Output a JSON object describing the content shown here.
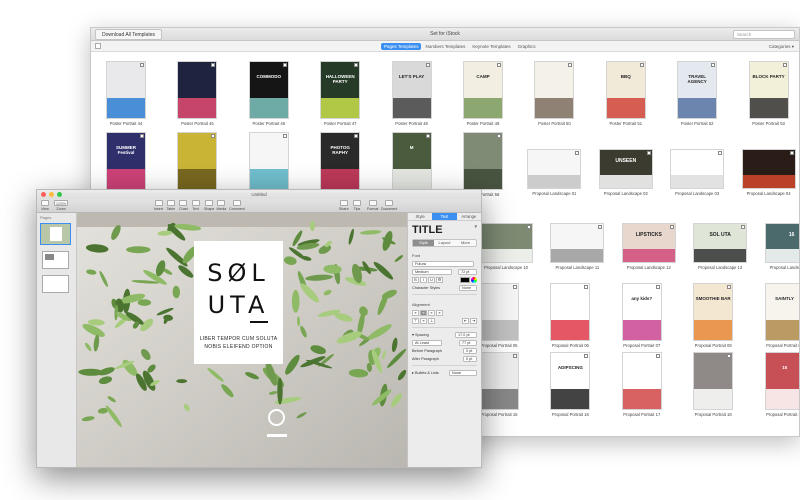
{
  "gallery": {
    "tab_label": "Download All Templates",
    "window_title": "Set for iStock",
    "search_placeholder": "Search",
    "tabs": [
      {
        "label": "Pages Templates",
        "active": true
      },
      {
        "label": "Numbers Templates",
        "active": false
      },
      {
        "label": "Keynote Templates",
        "active": false
      },
      {
        "label": "Graphics",
        "active": false
      }
    ],
    "categories_label": "Categories",
    "rows": [
      [
        {
          "caption": "Poster Portrait 44",
          "text": "",
          "bg": "#e9e9ec",
          "accent": "#2c7fd3"
        },
        {
          "caption": "Poster Portrait 45",
          "text": "",
          "bg": "#1e2340",
          "accent": "#e34b73"
        },
        {
          "caption": "Poster Portrait 46",
          "text": "COMMODO",
          "bg": "#151515",
          "accent": "#7ec6c1"
        },
        {
          "caption": "Poster Portrait 47",
          "text": "HALLOWEEN PARTY",
          "bg": "#263a28",
          "accent": "#c9e24a"
        },
        {
          "caption": "Poster Portrait 48",
          "text": "LET'S PLAY",
          "bg": "#d9d9d9",
          "accent": "#444444"
        },
        {
          "caption": "Poster Portrait 49",
          "text": "CAMP",
          "bg": "#f2efe2",
          "accent": "#7a9a5a"
        },
        {
          "caption": "Poster Portrait 50",
          "text": "",
          "bg": "#f4f1e8",
          "accent": "#7c6f5f"
        },
        {
          "caption": "Poster Portrait 51",
          "text": "BBQ",
          "bg": "#f1ead8",
          "accent": "#d1443b"
        },
        {
          "caption": "Poster Portrait 52",
          "text": "TRAVEL AGENCY",
          "bg": "#e4e9ef",
          "accent": "#5673a3"
        },
        {
          "caption": "Poster Portrait 53",
          "text": "BLOCK PARTY",
          "bg": "#f3f0d9",
          "accent": "#333333"
        }
      ],
      [
        {
          "caption": "",
          "text": "SUMMER Festival",
          "bg": "#2e2f6b",
          "accent": "#e9457a"
        },
        {
          "caption": "",
          "text": "",
          "bg": "#c9b436",
          "accent": "#6a5a1b"
        },
        {
          "caption": "",
          "text": "",
          "bg": "#f6f6f6",
          "accent": "#58b4c6"
        },
        {
          "caption": "",
          "text": "PHOTOG RAPHY",
          "bg": "#2a2a2a",
          "accent": "#d63b61"
        },
        {
          "caption": "",
          "text": "M",
          "bg": "#4b5b3e",
          "accent": "#ffffff"
        },
        {
          "caption": "Poster Portrait 58",
          "text": "",
          "bg": "#7f8b74",
          "accent": "#3e4a36"
        },
        {
          "caption": "Proposal Landscape 01",
          "text": "",
          "bg": "#f6f6f6",
          "accent": "#c4c4c4"
        },
        {
          "caption": "Proposal Landscape 02",
          "text": "UNSEEN",
          "bg": "#3b3b30",
          "accent": "#ffffff"
        },
        {
          "caption": "Proposal Landscape 03",
          "text": "",
          "bg": "#ffffff",
          "accent": "#dddddd"
        },
        {
          "caption": "Proposal Landscape 04",
          "text": "",
          "bg": "#2a1d17",
          "accent": "#d5492c"
        }
      ],
      [
        {
          "caption": "Proposal Landscape 10",
          "text": "",
          "bg": "#7d8b73",
          "accent": "#ffffff"
        },
        {
          "caption": "Proposal Landscape 11",
          "text": "",
          "bg": "#f6f6f6",
          "accent": "#9a9a9a"
        },
        {
          "caption": "Proposal Landscape 12",
          "text": "LIPSTICKS",
          "bg": "#e7d7cd",
          "accent": "#d04a7a"
        },
        {
          "caption": "Proposal Landscape 13",
          "text": "SOL UTA",
          "bg": "#dfe6d7",
          "accent": "#333333"
        },
        {
          "caption": "Proposal Landscape 14",
          "text": "16",
          "bg": "#4b6a6c",
          "accent": "#ffffff"
        }
      ],
      [
        {
          "caption": "Proposal Portrait 05",
          "text": "",
          "bg": "#f4f4f4",
          "accent": "#b6b6b6"
        },
        {
          "caption": "Proposal Portrait 06",
          "text": "",
          "bg": "#ffffff",
          "accent": "#e23a4a"
        },
        {
          "caption": "Proposal Portrait 07",
          "text": "any kids?",
          "bg": "#ffffff",
          "accent": "#c94591"
        },
        {
          "caption": "Proposal Portrait 08",
          "text": "SMOOTHIE BAR",
          "bg": "#f3e7d2",
          "accent": "#e78a3b"
        },
        {
          "caption": "Proposal Portrait 09",
          "text": "SAINTLY",
          "bg": "#f7f4ee",
          "accent": "#b28a4a"
        }
      ],
      [
        {
          "caption": "Proposal Portrait 15",
          "text": "",
          "bg": "#ececec",
          "accent": "#777777"
        },
        {
          "caption": "Proposal Portrait 16",
          "text": "ADIPSCING",
          "bg": "#ffffff",
          "accent": "#222222"
        },
        {
          "caption": "Proposal Portrait 17",
          "text": "",
          "bg": "#ffffff",
          "accent": "#d14545"
        },
        {
          "caption": "Proposal Portrait 18",
          "text": "",
          "bg": "#8f8a87",
          "accent": "#ffffff"
        },
        {
          "caption": "Proposal Portrait 19",
          "text": "15",
          "bg": "#c74f56",
          "accent": "#ffffff"
        }
      ]
    ]
  },
  "pages": {
    "window_title": "Untitled",
    "toolbar": {
      "left": [
        {
          "icon": "view-icon",
          "label": "View"
        },
        {
          "icon": "zoom-icon",
          "label": "Zoom",
          "value": "125%"
        }
      ],
      "center": [
        {
          "icon": "insert-icon",
          "label": "Insert"
        },
        {
          "icon": "table-icon",
          "label": "Table"
        },
        {
          "icon": "chart-icon",
          "label": "Chart"
        },
        {
          "icon": "text-icon",
          "label": "Text"
        },
        {
          "icon": "shape-icon",
          "label": "Shape"
        },
        {
          "icon": "media-icon",
          "label": "Media"
        },
        {
          "icon": "comment-icon",
          "label": "Comment"
        }
      ],
      "right": [
        {
          "icon": "share-icon",
          "label": "Share"
        },
        {
          "icon": "tips-icon",
          "label": "Tips"
        },
        {
          "icon": "format-icon",
          "label": "Format"
        },
        {
          "icon": "document-icon",
          "label": "Document"
        }
      ]
    },
    "sidebar_title": "Pages",
    "document": {
      "title_line1": "SØL",
      "title_line2": "UTA",
      "subtitle_line1": "LIBER TEMPOR CUM SOLUTA",
      "subtitle_line2": "NOBIS ELEIFEND OPTION",
      "colors": {
        "salad": "#6f9a4e",
        "board": "#cfcfc8"
      }
    },
    "inspector": {
      "tabs": [
        {
          "label": "Style",
          "active": false
        },
        {
          "label": "Text",
          "active": true
        },
        {
          "label": "Arrange",
          "active": false
        }
      ],
      "paragraph_style": "TITLE",
      "segments": [
        {
          "label": "Style",
          "active": true
        },
        {
          "label": "Layout",
          "active": false
        },
        {
          "label": "More",
          "active": false
        }
      ],
      "font_label": "Font",
      "font_name": "Futura",
      "font_weight": "Medium",
      "font_size": "72 pt",
      "format_buttons": [
        "B",
        "I",
        "U",
        "⚙"
      ],
      "character_styles_label": "Character Styles",
      "character_styles_value": "None",
      "alignment_label": "Alignment",
      "spacing_label": "Spacing",
      "spacing_value": "17.0 pt",
      "line_spacing_label": "At Least",
      "line_spacing_value": "77 pt",
      "before_paragraph_label": "Before Paragraph",
      "before_paragraph_value": "0 pt",
      "after_paragraph_label": "After Paragraph",
      "after_paragraph_value": "0 pt",
      "bullets_label": "Bullets & Lists",
      "bullets_value": "None"
    }
  },
  "colors": {
    "accent": "#3b8ff1",
    "close": "#fc605c",
    "minimize": "#fdbc40",
    "zoom": "#34c84a"
  }
}
